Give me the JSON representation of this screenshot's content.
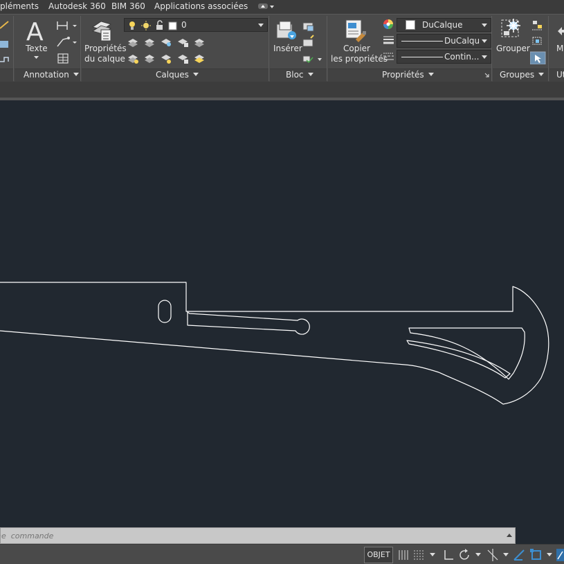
{
  "menu_tabs": [
    "pléments",
    "Autodesk 360",
    "BIM 360",
    "Applications associées"
  ],
  "ribbon": {
    "annotation": {
      "title": "Annotation",
      "text_label": "Texte"
    },
    "calques": {
      "title": "Calques",
      "props_label_1": "Propriétés",
      "props_label_2": "du calque",
      "layer_value": "0"
    },
    "bloc": {
      "title": "Bloc",
      "insert_label": "Insérer"
    },
    "proprietes": {
      "title": "Propriétés",
      "copy_label_1": "Copier",
      "copy_label_2": "les propriétés",
      "color_value": "DuCalque",
      "lineweight_value": "DuCalqu",
      "linetype_value": "Contin..."
    },
    "groupes": {
      "title": "Groupes",
      "group_label": "Grouper"
    },
    "next_panel_title": "Ut",
    "next_panel_label": "M"
  },
  "command_line": {
    "placeholder": "ne  commande"
  },
  "status_bar": {
    "objet_label": "OBJET"
  },
  "colors": {
    "canvas": "#212830",
    "ribbon": "#4a4a4a",
    "drawing_stroke": "#ffffff",
    "accent_blue": "#3d8fd1"
  }
}
